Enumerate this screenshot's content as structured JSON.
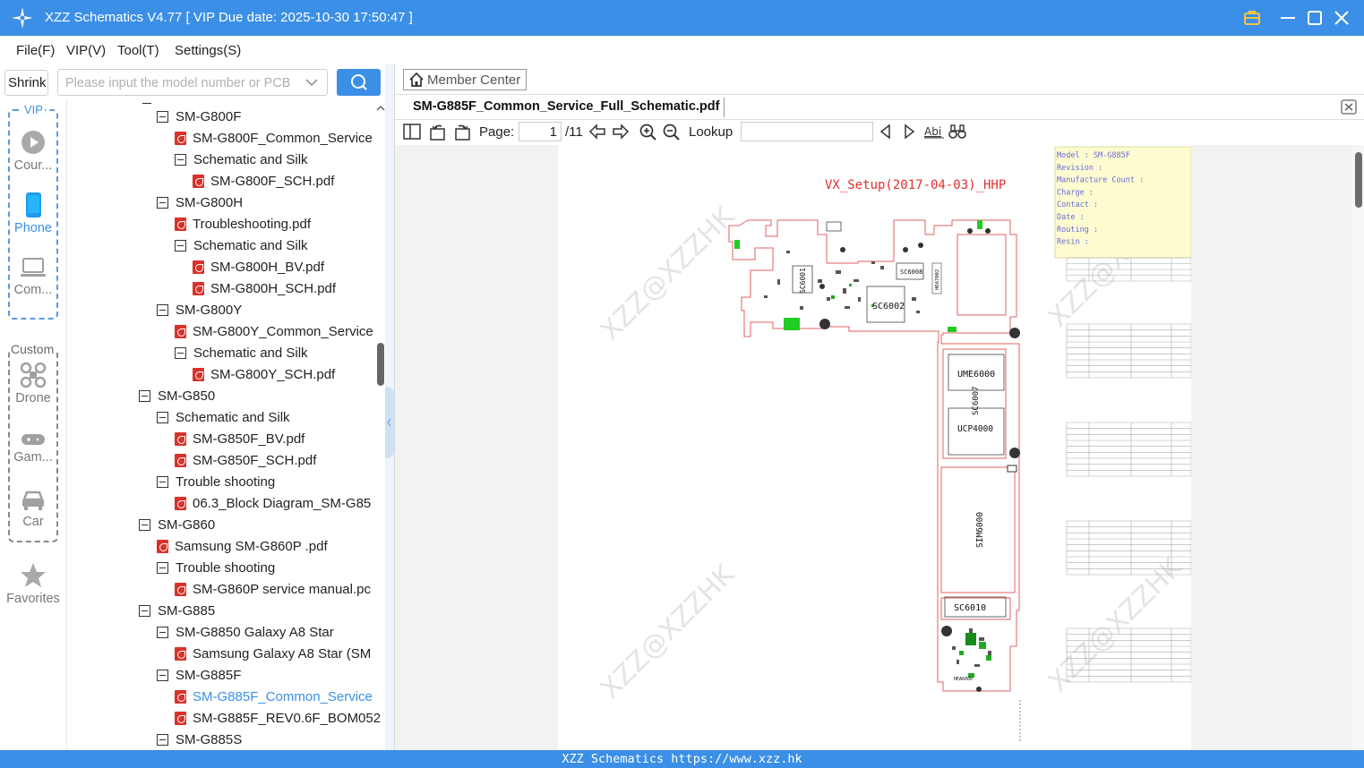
{
  "window": {
    "title": "XZZ Schematics V4.77 [ VIP Due date: 2025-10-30 17:50:47 ]"
  },
  "menu": {
    "file": "File(F)",
    "vip": "VIP(V)",
    "tool": "Tool(T)",
    "settings": "Settings(S)"
  },
  "toolbar_left": {
    "shrink": "Shrink",
    "search_placeholder": "Please input the model number or PCB"
  },
  "sidebar": {
    "vip_label": "VIP",
    "custom_label": "Custom",
    "items": [
      {
        "label": "Cour...",
        "icon": "play-circle-icon"
      },
      {
        "label": "Phone",
        "icon": "phone-icon"
      },
      {
        "label": "Com...",
        "icon": "laptop-icon"
      },
      {
        "label": "Drone",
        "icon": "drone-icon"
      },
      {
        "label": "Gam...",
        "icon": "gamepad-icon"
      },
      {
        "label": "Car",
        "icon": "car-icon"
      },
      {
        "label": "Favorites",
        "icon": "star-icon"
      }
    ]
  },
  "tree": [
    {
      "label": "SM-G800F",
      "type": "folder"
    },
    {
      "label": "SM-G800F_Common_Service",
      "type": "pdf"
    },
    {
      "label": "Schematic and Silk",
      "type": "folder"
    },
    {
      "label": "SM-G800F_SCH.pdf",
      "type": "pdf"
    },
    {
      "label": "SM-G800H",
      "type": "folder"
    },
    {
      "label": "Troubleshooting.pdf",
      "type": "pdf"
    },
    {
      "label": "Schematic and Silk",
      "type": "folder"
    },
    {
      "label": "SM-G800H_BV.pdf",
      "type": "pdf"
    },
    {
      "label": "SM-G800H_SCH.pdf",
      "type": "pdf"
    },
    {
      "label": "SM-G800Y",
      "type": "folder"
    },
    {
      "label": "SM-G800Y_Common_Service",
      "type": "pdf"
    },
    {
      "label": "Schematic and Silk",
      "type": "folder"
    },
    {
      "label": "SM-G800Y_SCH.pdf",
      "type": "pdf"
    },
    {
      "label": "SM-G850",
      "type": "folder"
    },
    {
      "label": "Schematic and Silk",
      "type": "folder"
    },
    {
      "label": "SM-G850F_BV.pdf",
      "type": "pdf"
    },
    {
      "label": "SM-G850F_SCH.pdf",
      "type": "pdf"
    },
    {
      "label": "Trouble shooting",
      "type": "folder"
    },
    {
      "label": "06.3_Block Diagram_SM-G85",
      "type": "pdf"
    },
    {
      "label": "SM-G860",
      "type": "folder"
    },
    {
      "label": "Samsung SM-G860P .pdf",
      "type": "pdf"
    },
    {
      "label": "Trouble shooting",
      "type": "folder"
    },
    {
      "label": "SM-G860P service manual.pc",
      "type": "pdf"
    },
    {
      "label": "SM-G885",
      "type": "folder"
    },
    {
      "label": "SM-G8850 Galaxy A8 Star",
      "type": "folder"
    },
    {
      "label": "Samsung Galaxy A8 Star (SM",
      "type": "pdf"
    },
    {
      "label": "SM-G885F",
      "type": "folder"
    },
    {
      "label": "SM-G885F_Common_Service",
      "type": "pdf",
      "selected": true
    },
    {
      "label": "SM-G885F_REV0.6F_BOM052",
      "type": "pdf"
    },
    {
      "label": "SM-G885S",
      "type": "folder"
    }
  ],
  "viewer": {
    "member_center": "Member Center",
    "tab_title": "SM-G885F_Common_Service_Full_Schematic.pdf",
    "page_label": "Page:",
    "current_page": "1",
    "total_pages": "/11",
    "lookup_label": "Lookup",
    "lookup_value": ""
  },
  "document": {
    "setup_title": "VX_Setup(2017-04-03)_HHP",
    "info_box": [
      "Model : SM-G885F",
      "Revision :",
      "Manufacture Count :",
      "Charge :",
      "Contact :",
      "Date :",
      "Routing :",
      "Resin :"
    ],
    "watermark": "XZZ@XZZHK",
    "components": [
      "SC6002",
      "SC6001",
      "SC6008",
      "UME6000",
      "SC6007",
      "UCP4000",
      "SIM6000",
      "SC6010",
      "HEA7002",
      "HEA6000"
    ]
  },
  "statusbar": {
    "text": "XZZ Schematics https://www.xzz.hk"
  },
  "colors": {
    "accent": "#3b8fe6",
    "pdf_red": "#d9322b",
    "pcb_outline": "#e06060",
    "info_box_bg": "#fdfbd0"
  }
}
